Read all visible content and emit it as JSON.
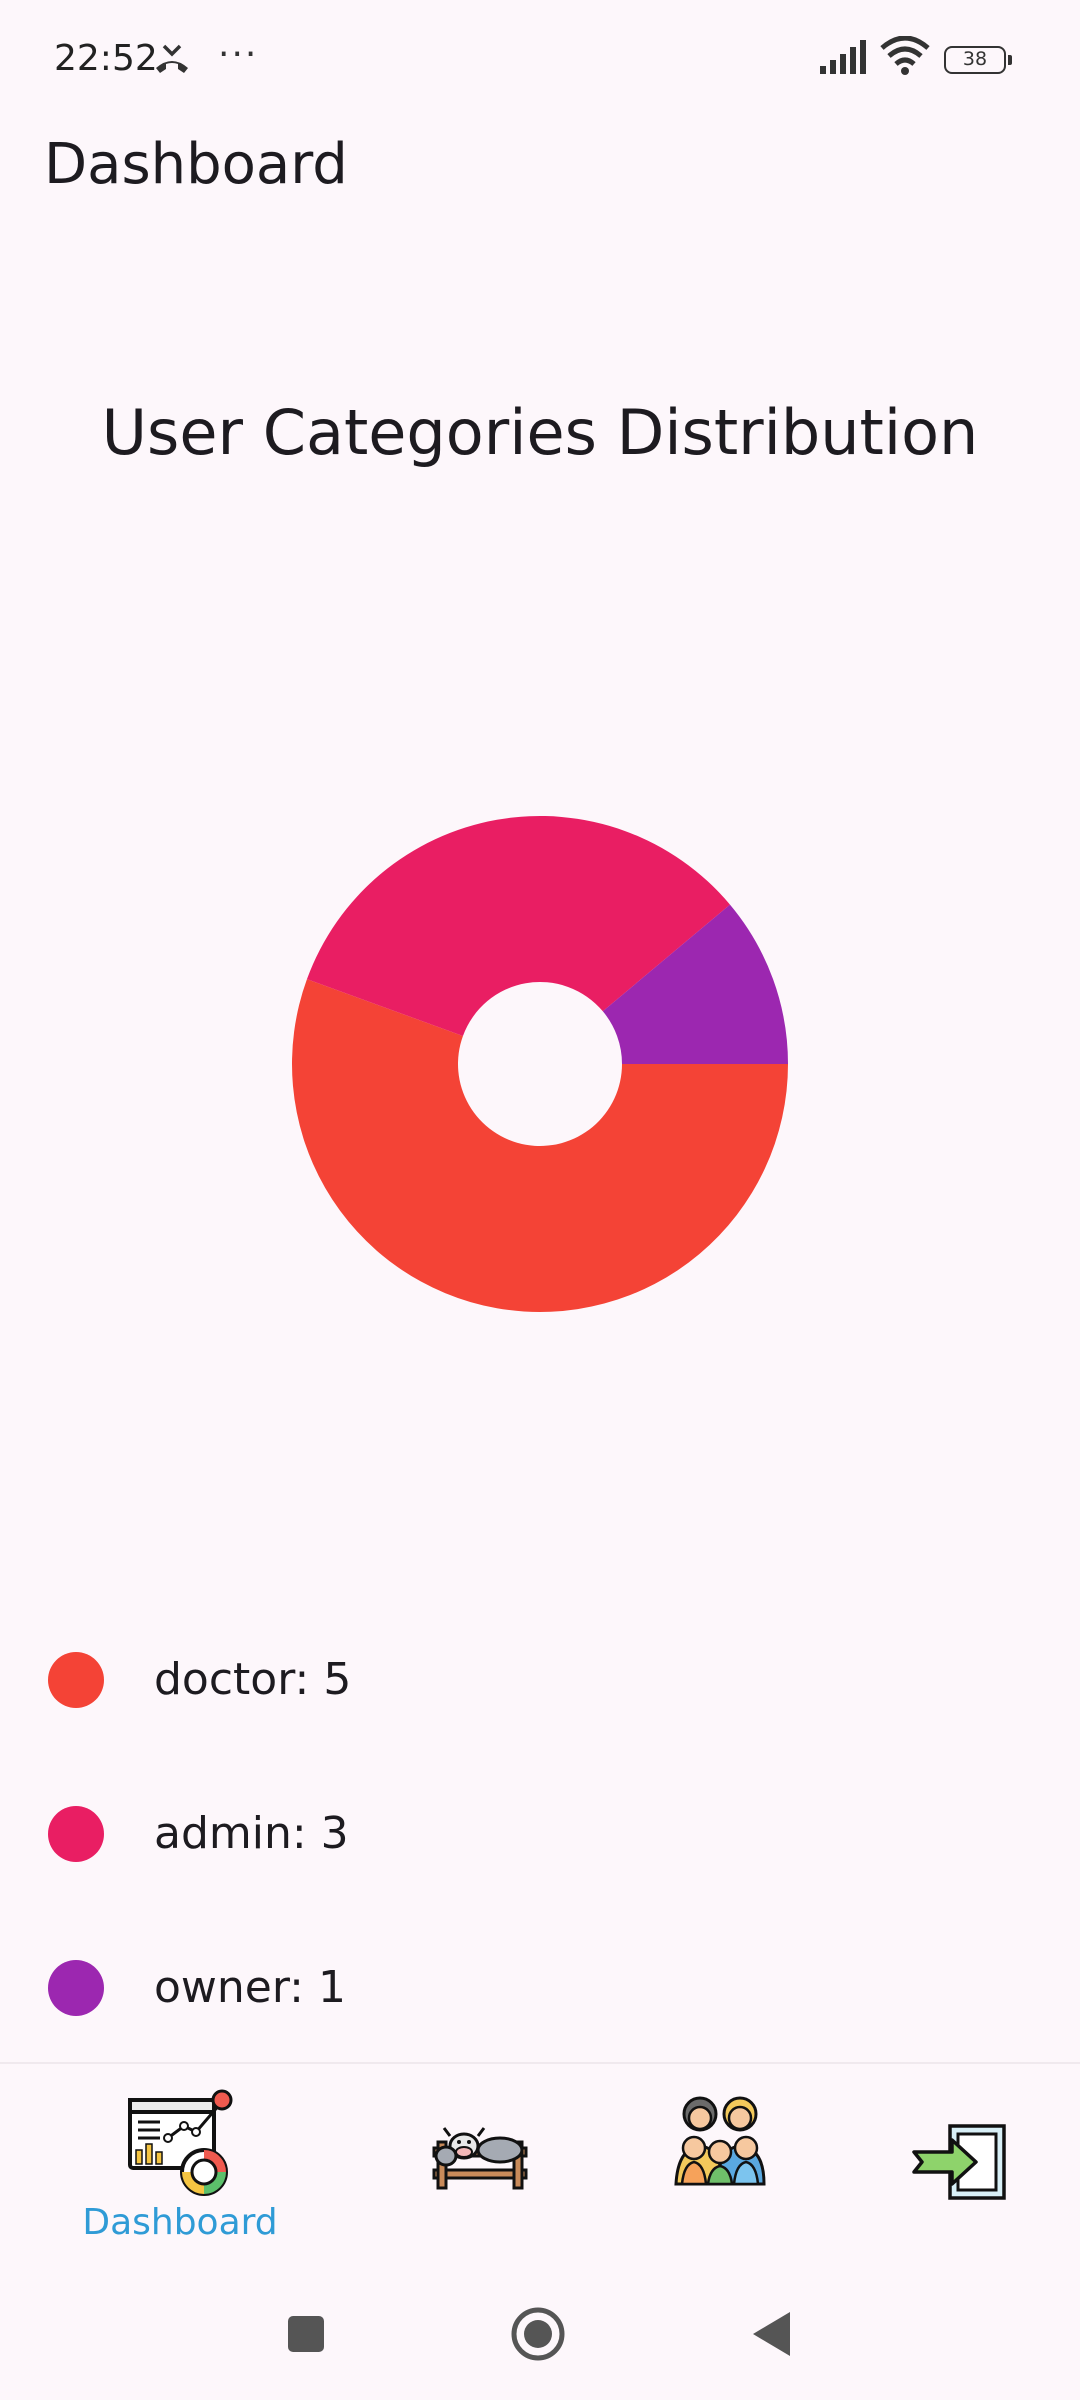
{
  "status_bar": {
    "time": "22:52",
    "dots": "···",
    "battery": "38"
  },
  "app_bar": {
    "title": "Dashboard"
  },
  "chart_data": {
    "type": "pie",
    "title": "User Categories Distribution",
    "donut": true,
    "categories": [
      "doctor",
      "admin",
      "owner"
    ],
    "values": [
      5,
      3,
      1
    ],
    "colors": [
      "#f44336",
      "#e91e63",
      "#9c27b0"
    ]
  },
  "legend": [
    {
      "label": "doctor: 5",
      "color": "#f44336"
    },
    {
      "label": "admin: 3",
      "color": "#e91e63"
    },
    {
      "label": "owner: 1",
      "color": "#9c27b0"
    }
  ],
  "bottom_nav": {
    "items": [
      {
        "icon": "dashboard-icon",
        "label": "Dashboard",
        "active": true
      },
      {
        "icon": "livestock-icon",
        "label": "",
        "active": false
      },
      {
        "icon": "users-icon",
        "label": "",
        "active": false
      },
      {
        "icon": "logout-icon",
        "label": "",
        "active": false
      }
    ],
    "active_color": "#2f9bd6"
  },
  "system_nav": {
    "buttons": [
      "recents-icon",
      "home-icon",
      "back-icon"
    ]
  }
}
